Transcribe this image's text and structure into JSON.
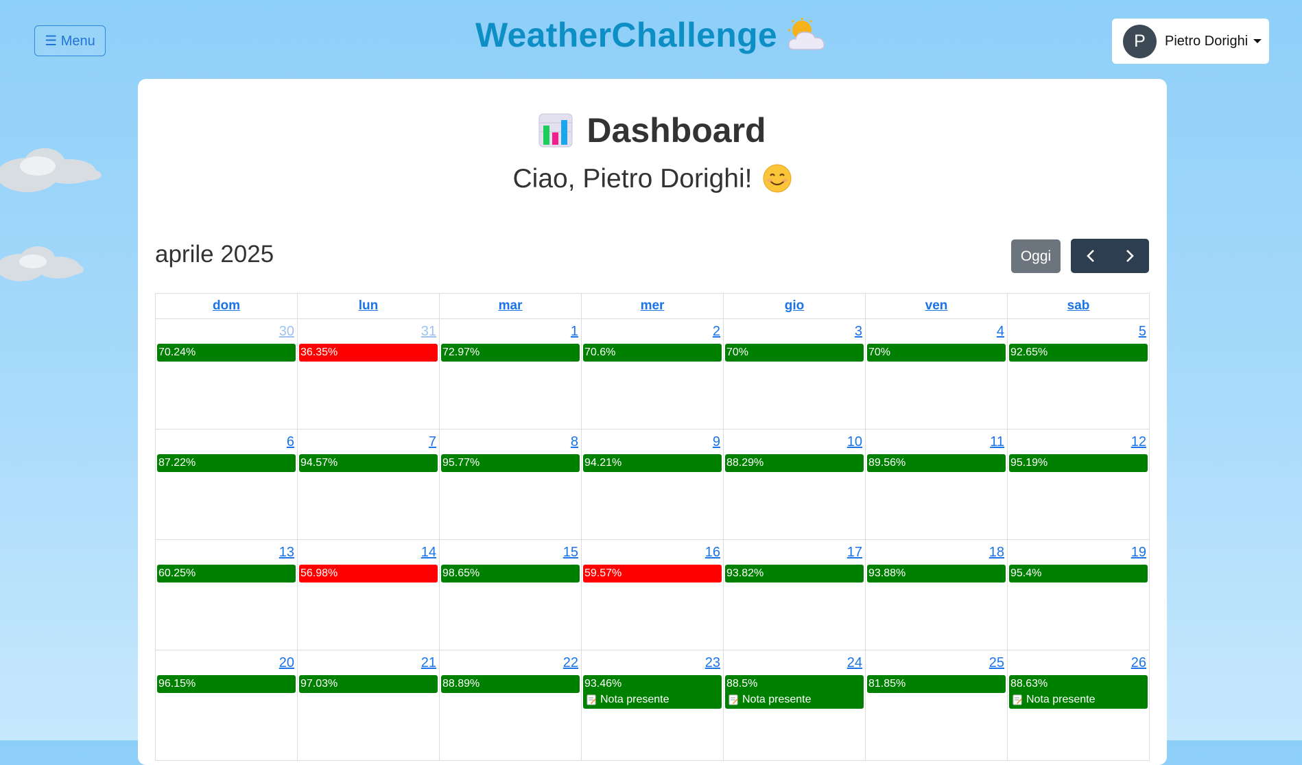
{
  "header": {
    "menu_label": "☰ Menu",
    "brand": "WeatherChallenge",
    "user": {
      "initial": "P",
      "name": "Pietro Dorighi"
    }
  },
  "dashboard": {
    "title": "Dashboard",
    "greeting": "Ciao, Pietro Dorighi!"
  },
  "calendar": {
    "month_label": "aprile 2025",
    "today_label": "Oggi",
    "weekdays": [
      "dom",
      "lun",
      "mar",
      "mer",
      "gio",
      "ven",
      "sab"
    ],
    "weeks": [
      [
        {
          "day": "30",
          "other": true,
          "score": "70.24%",
          "status": "green"
        },
        {
          "day": "31",
          "other": true,
          "score": "36.35%",
          "status": "red"
        },
        {
          "day": "1",
          "score": "72.97%",
          "status": "green"
        },
        {
          "day": "2",
          "score": "70.6%",
          "status": "green"
        },
        {
          "day": "3",
          "score": "70%",
          "status": "green"
        },
        {
          "day": "4",
          "score": "70%",
          "status": "green"
        },
        {
          "day": "5",
          "score": "92.65%",
          "status": "green"
        }
      ],
      [
        {
          "day": "6",
          "score": "87.22%",
          "status": "green"
        },
        {
          "day": "7",
          "score": "94.57%",
          "status": "green"
        },
        {
          "day": "8",
          "score": "95.77%",
          "status": "green"
        },
        {
          "day": "9",
          "score": "94.21%",
          "status": "green"
        },
        {
          "day": "10",
          "score": "88.29%",
          "status": "green"
        },
        {
          "day": "11",
          "score": "89.56%",
          "status": "green"
        },
        {
          "day": "12",
          "score": "95.19%",
          "status": "green"
        }
      ],
      [
        {
          "day": "13",
          "score": "60.25%",
          "status": "green"
        },
        {
          "day": "14",
          "score": "56.98%",
          "status": "red"
        },
        {
          "day": "15",
          "score": "98.65%",
          "status": "green"
        },
        {
          "day": "16",
          "score": "59.57%",
          "status": "red"
        },
        {
          "day": "17",
          "score": "93.82%",
          "status": "green"
        },
        {
          "day": "18",
          "score": "93.88%",
          "status": "green"
        },
        {
          "day": "19",
          "score": "95.4%",
          "status": "green"
        }
      ],
      [
        {
          "day": "20",
          "score": "96.15%",
          "status": "green"
        },
        {
          "day": "21",
          "score": "97.03%",
          "status": "green"
        },
        {
          "day": "22",
          "score": "88.89%",
          "status": "green"
        },
        {
          "day": "23",
          "score": "93.46%",
          "status": "green",
          "note": "Nota presente"
        },
        {
          "day": "24",
          "score": "88.5%",
          "status": "green",
          "note": "Nota presente"
        },
        {
          "day": "25",
          "score": "81.85%",
          "status": "green"
        },
        {
          "day": "26",
          "score": "88.63%",
          "status": "green",
          "note": "Nota presente"
        }
      ]
    ]
  },
  "colors": {
    "green": "#008000",
    "red": "#ff0000",
    "brand": "#0d8fc6"
  }
}
